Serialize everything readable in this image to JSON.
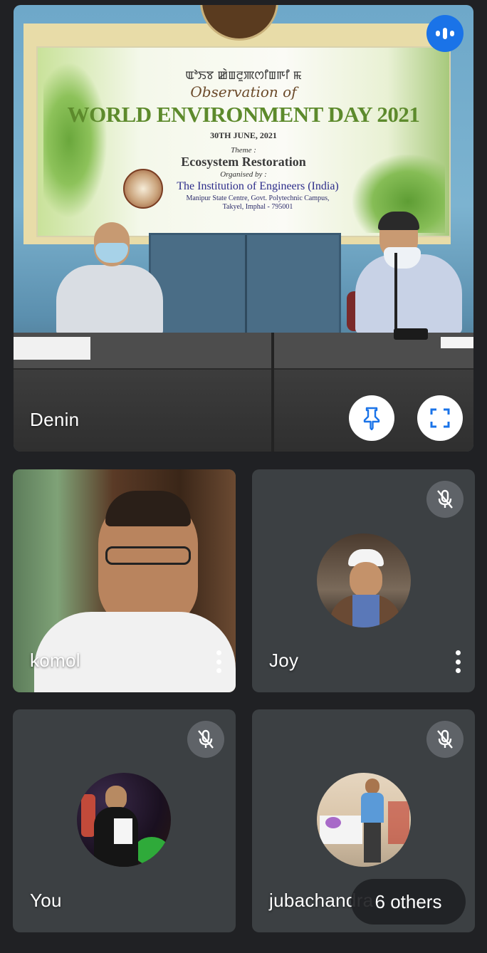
{
  "main_tile": {
    "participant_name": "Denin",
    "banner": {
      "script_line": "ꯑꯣꯏꯕ ꯀꯥꯡꯂꯨꯄꯁꯤꯡꯒꯤ ꯃ",
      "observation": "Observation of",
      "title": "WORLD ENVIRONMENT DAY 2021",
      "date": "30TH JUNE, 2021",
      "theme_label": "Theme :",
      "theme": "Ecosystem Restoration",
      "organised_by": "Organised by :",
      "institution": "The Institution of Engineers (India)",
      "address_line1": "Manipur State Centre, Govt. Polytechnic Campus,",
      "address_line2": "Takyel, Imphal - 795001"
    },
    "speaking_indicator_icon": "audio-level-icon",
    "pin_icon": "pin-icon",
    "fullscreen_icon": "fullscreen-icon"
  },
  "tiles": [
    {
      "name": "komol",
      "muted": false,
      "video_on": true
    },
    {
      "name": "Joy",
      "muted": true,
      "video_on": false
    },
    {
      "name": "You",
      "muted": true,
      "video_on": false
    },
    {
      "name": "jubachandra",
      "muted": true,
      "video_on": false
    }
  ],
  "others_pill": {
    "label": "6 others"
  },
  "colors": {
    "background": "#202124",
    "tile": "#3c4043",
    "accent_blue": "#1a73e8",
    "mute_badge": "#5f6368"
  }
}
